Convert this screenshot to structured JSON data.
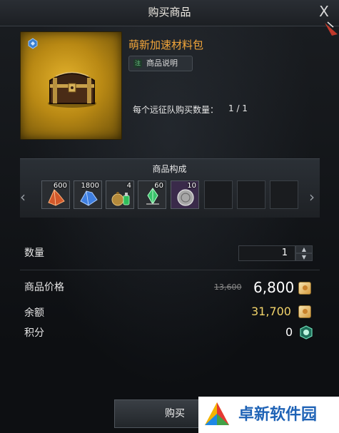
{
  "dialog": {
    "title": "购买商品",
    "close_label": "X"
  },
  "product": {
    "name": "萌新加速材料包",
    "desc_tag": "注",
    "desc_button": "商品说明",
    "limit_label": "每个远征队购买数量：",
    "limit_value": "1 / 1",
    "image_icon": "treasure-chest-icon"
  },
  "composition": {
    "title": "商品构成",
    "items": [
      {
        "qty": "600",
        "icon": "red-crystal-icon",
        "color": "#d2582a"
      },
      {
        "qty": "1800",
        "icon": "blue-crystal-icon",
        "color": "#3f7fe0"
      },
      {
        "qty": "4",
        "icon": "pouch-and-potion-icon",
        "color": "#b58a3b"
      },
      {
        "qty": "60",
        "icon": "green-leapstone-icon",
        "color": "#38c26a"
      },
      {
        "qty": "10",
        "icon": "silver-coin-icon",
        "color": "#a7a7a7"
      }
    ],
    "empty_slots": 3
  },
  "quantity": {
    "label": "数量",
    "value": "1"
  },
  "price": {
    "label": "商品价格",
    "original": "13,600",
    "sale": "6,800",
    "currency_icon": "gold-bar-icon"
  },
  "balance": {
    "label": "余额",
    "value": "31,700"
  },
  "points": {
    "label": "积分",
    "value": "0",
    "icon": "point-badge-icon"
  },
  "buy_button": "购买",
  "watermark": {
    "text": "卓新软件园"
  }
}
